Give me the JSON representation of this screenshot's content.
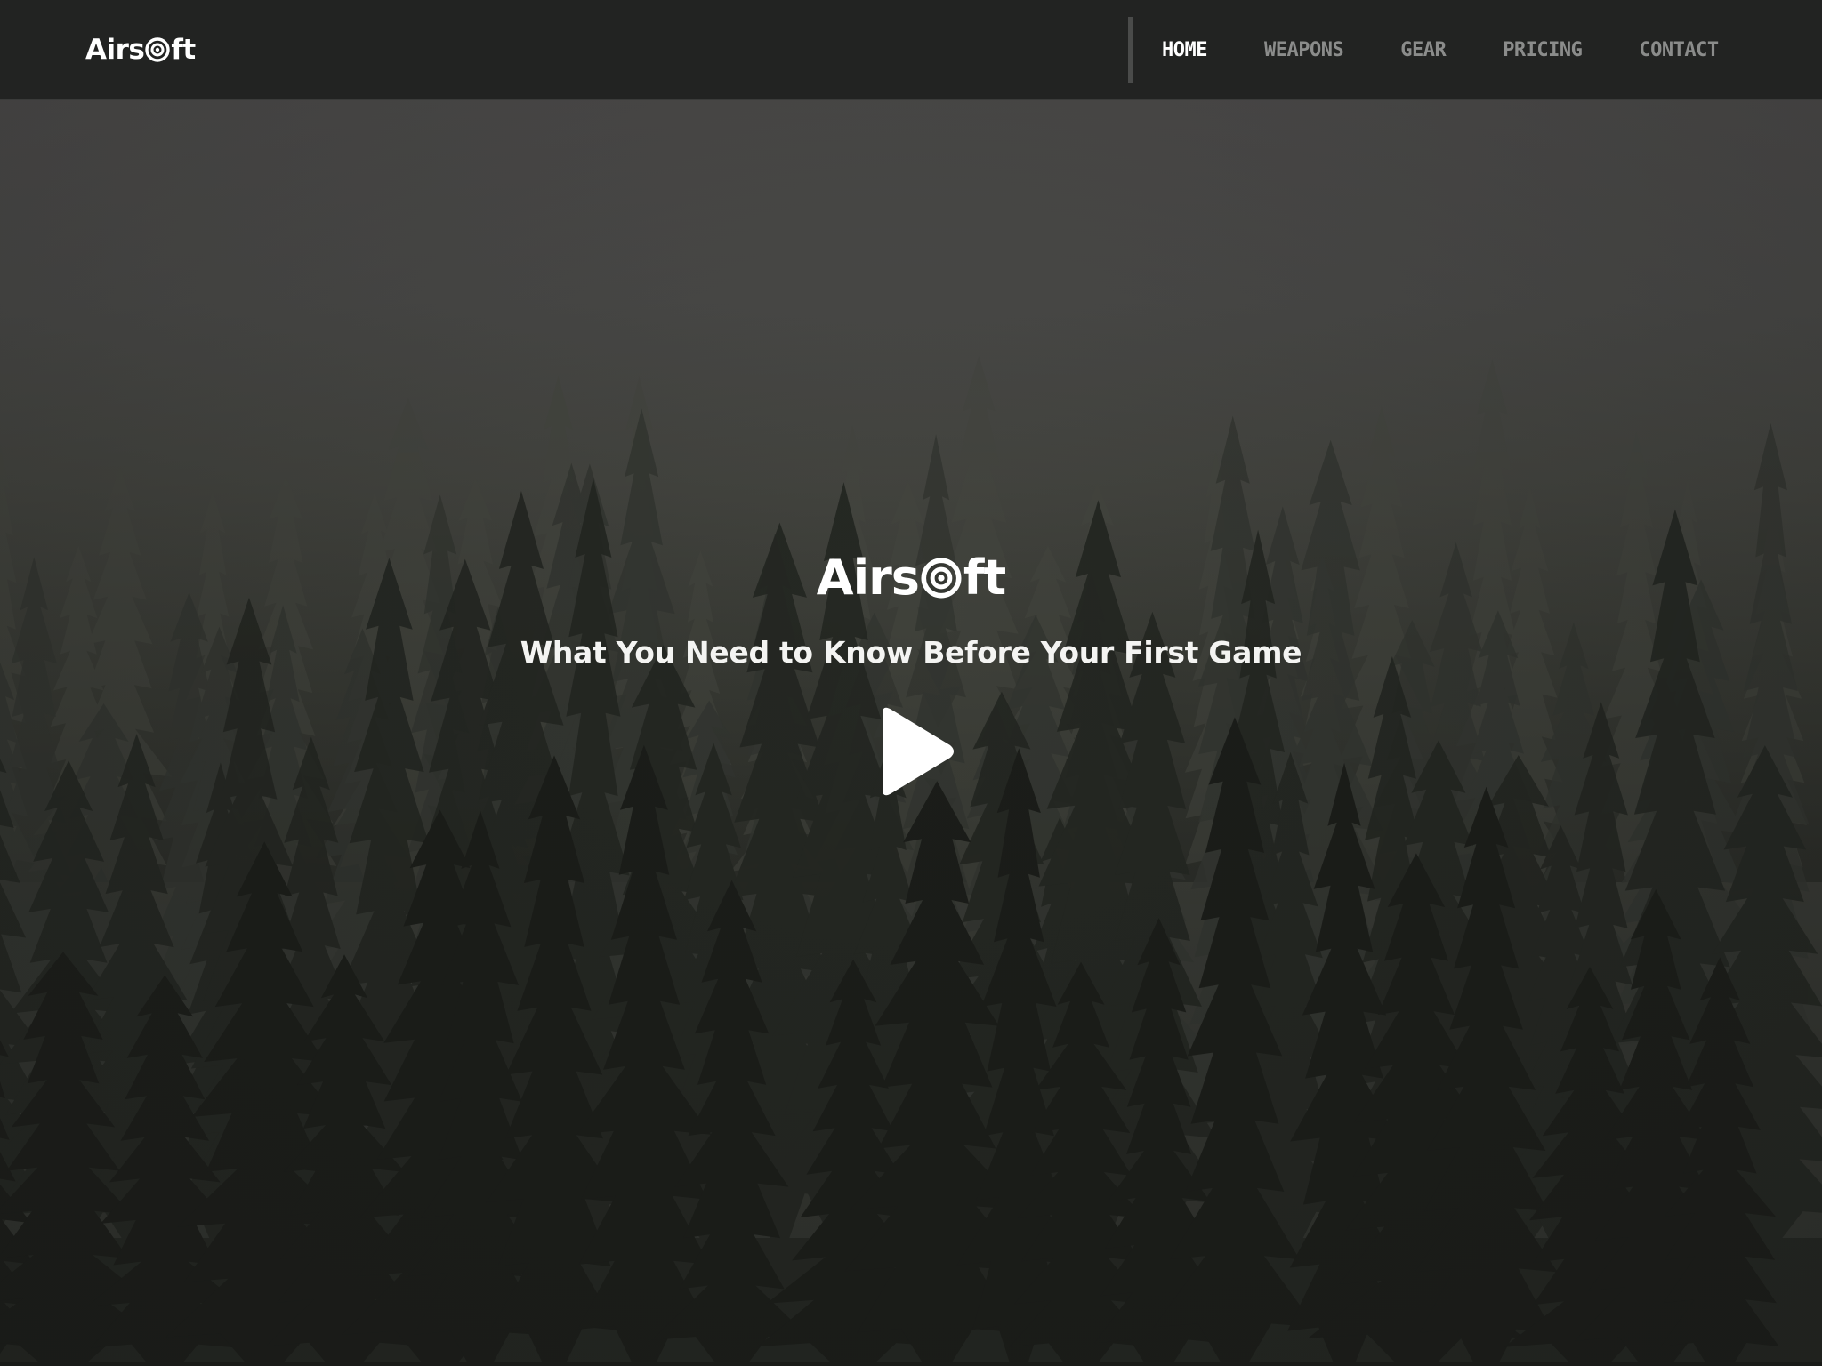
{
  "header": {
    "brand_prefix": "Airs",
    "brand_suffix": "ft",
    "brand_mark_icon": "target-icon"
  },
  "nav": {
    "items": [
      {
        "label": "HOME",
        "active": true
      },
      {
        "label": "WEAPONS",
        "active": false
      },
      {
        "label": "GEAR",
        "active": false
      },
      {
        "label": "PRICING",
        "active": false
      },
      {
        "label": "CONTACT",
        "active": false
      }
    ]
  },
  "hero": {
    "title_prefix": "Airs",
    "title_suffix": "ft",
    "subtitle": "What You Need to Know Before Your First Game",
    "play_icon": "play-icon",
    "background": "misty pine forest"
  },
  "colors": {
    "navbar_bg": "#222322",
    "nav_active": "#ffffff",
    "nav_inactive": "#8b8c8b",
    "text": "#ffffff"
  }
}
